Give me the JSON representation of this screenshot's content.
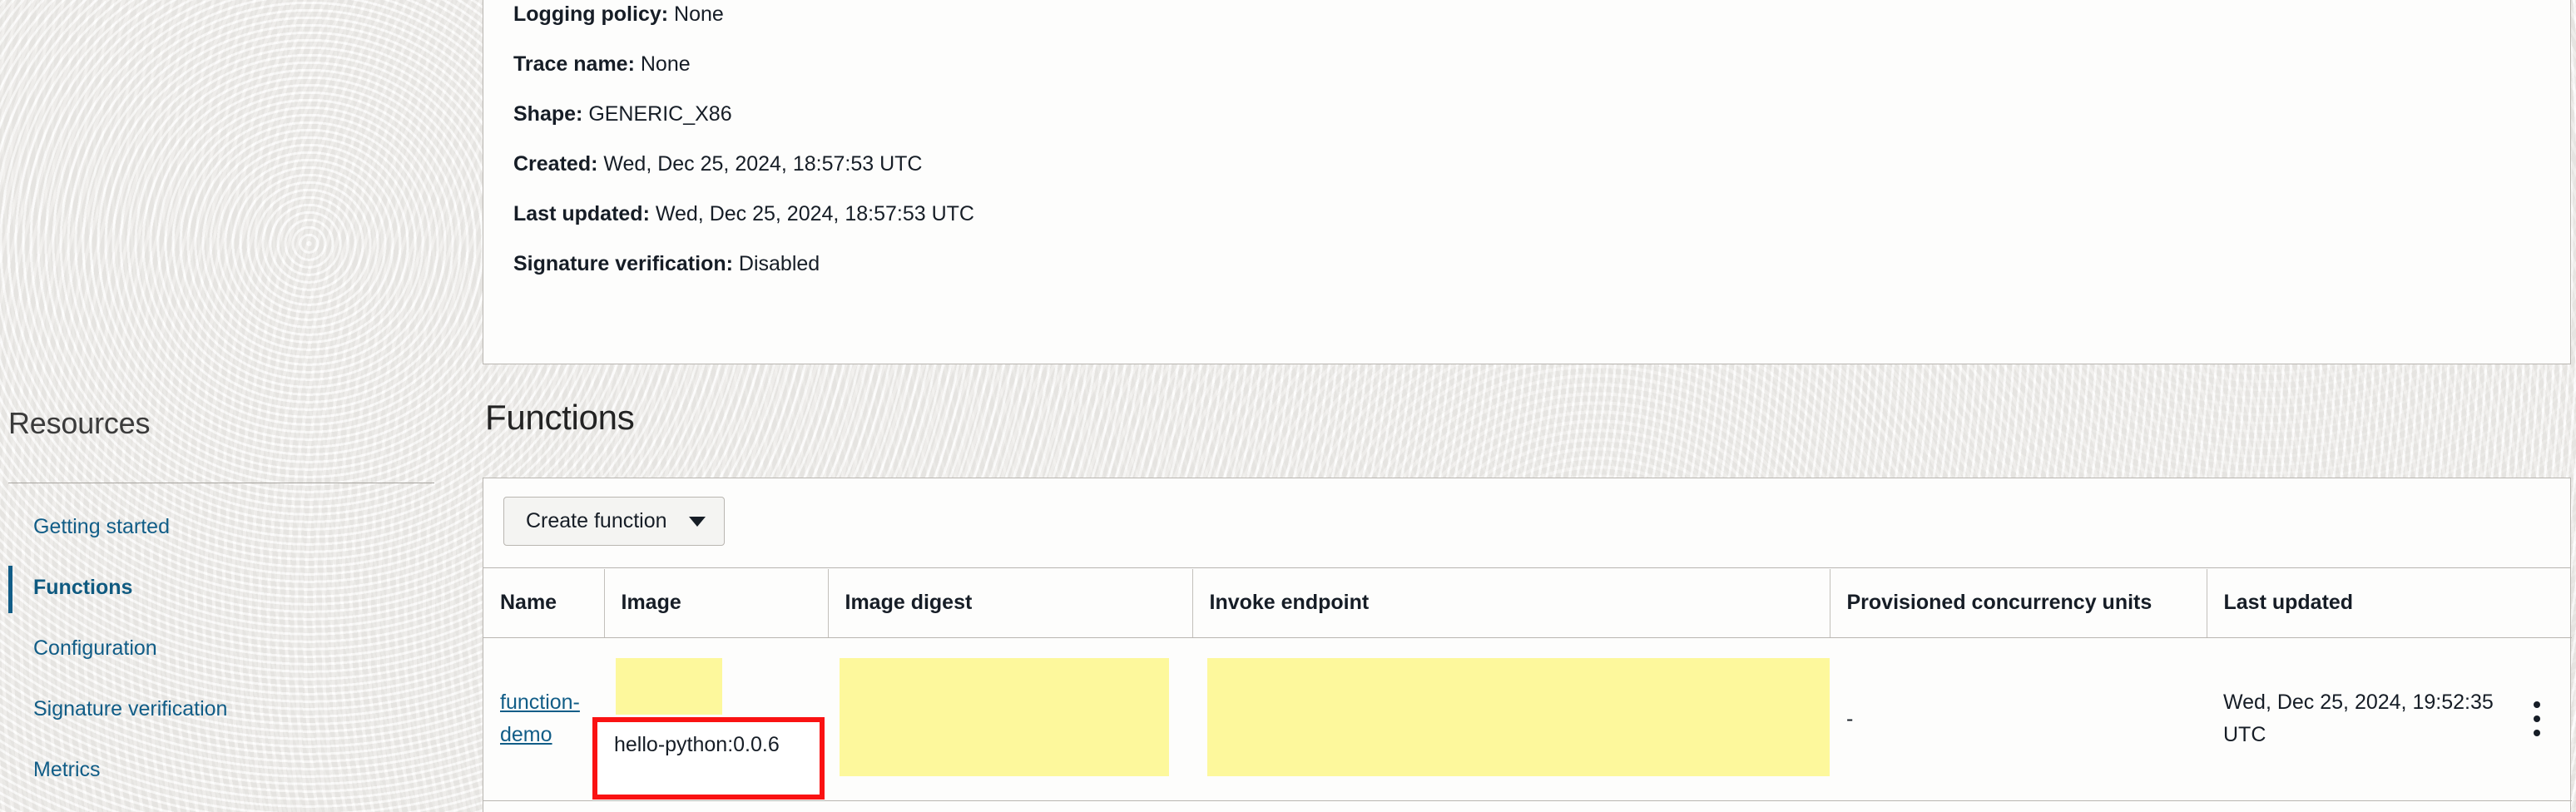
{
  "sidebar": {
    "title": "Resources",
    "items": [
      {
        "label": "Getting started",
        "active": false
      },
      {
        "label": "Functions",
        "active": true
      },
      {
        "label": "Configuration",
        "active": false
      },
      {
        "label": "Signature verification",
        "active": false
      },
      {
        "label": "Metrics",
        "active": false
      }
    ]
  },
  "details": [
    {
      "label": "Logging policy:",
      "value": "None"
    },
    {
      "label": "Trace name:",
      "value": "None"
    },
    {
      "label": "Shape:",
      "value": "GENERIC_X86"
    },
    {
      "label": "Created:",
      "value": "Wed, Dec 25, 2024, 18:57:53 UTC"
    },
    {
      "label": "Last updated:",
      "value": "Wed, Dec 25, 2024, 18:57:53 UTC"
    },
    {
      "label": "Signature verification:",
      "value": "Disabled"
    }
  ],
  "functions_section": {
    "heading": "Functions",
    "create_button": "Create function",
    "columns": [
      "Name",
      "Image",
      "Image digest",
      "Invoke endpoint",
      "Provisioned concurrency units",
      "Last updated"
    ],
    "rows": [
      {
        "name": "function-demo",
        "image": "",
        "image_digest": "",
        "invoke_endpoint": "",
        "provisioned_concurrency_units": "-",
        "last_updated": "Wed, Dec 25, 2024, 19:52:35 UTC"
      }
    ]
  },
  "annotation": {
    "text": "hello-python:0.0.6",
    "border_color": "#fa1212"
  },
  "colors": {
    "link": "#115d87",
    "page_background": "#f2f1ef",
    "card_background": "#fdfdfc",
    "redaction": "#fdf89c",
    "border": "#b9b6b1"
  }
}
